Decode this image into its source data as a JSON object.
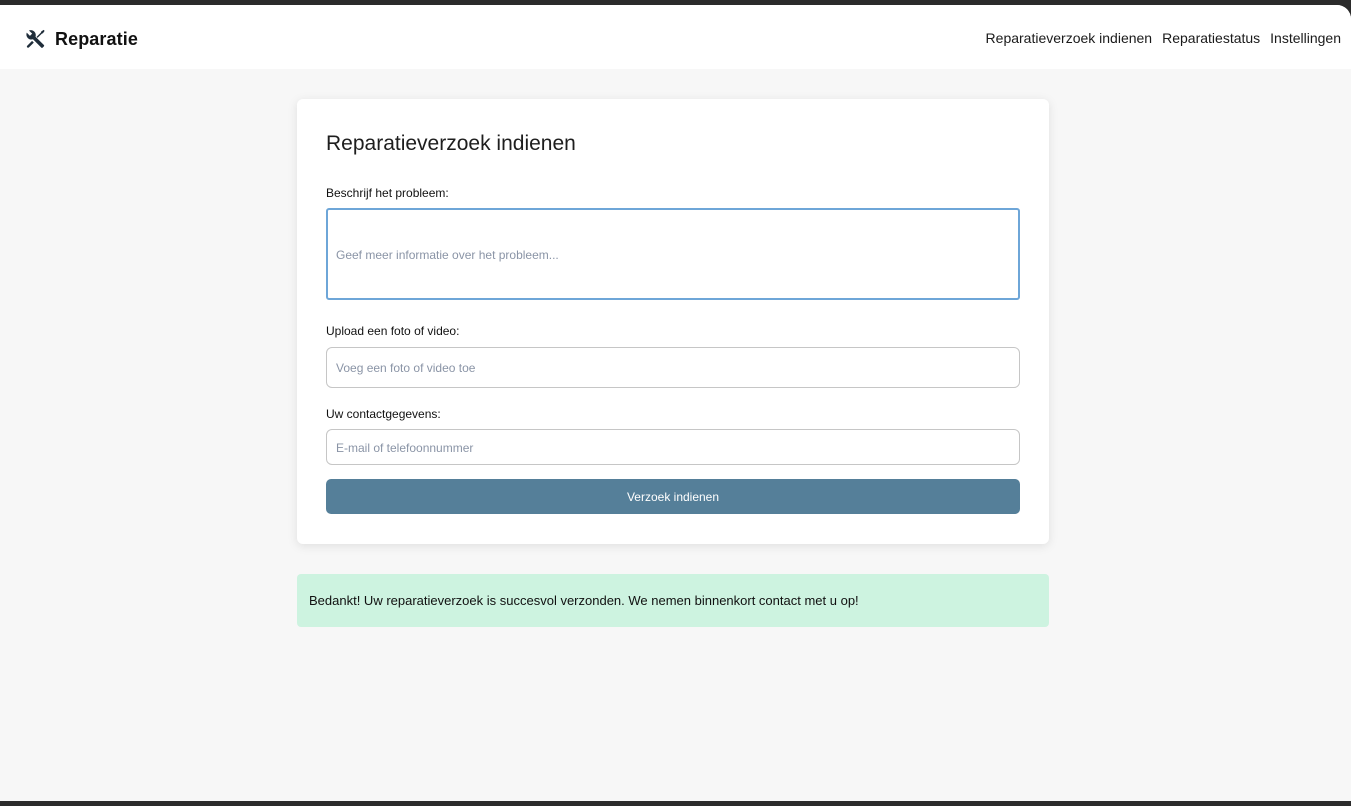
{
  "brand": {
    "name": "Reparatie",
    "icon": "tools-icon"
  },
  "nav": {
    "items": [
      "Reparatieverzoek indienen",
      "Reparatiestatus",
      "Instellingen"
    ]
  },
  "form": {
    "title": "Reparatieverzoek indienen",
    "description": {
      "label": "Beschrijf het probleem:",
      "placeholder": "Geef meer informatie over het probleem..."
    },
    "upload": {
      "label": "Upload een foto of video:",
      "placeholder": "Voeg een foto of video toe"
    },
    "contact": {
      "label": "Uw contactgegevens:",
      "placeholder": "E-mail of telefoonnummer"
    },
    "submit_label": "Verzoek indienen"
  },
  "success_message": "Bedankt! Uw reparatieverzoek is succesvol verzonden. We nemen binnenkort contact met u op!",
  "colors": {
    "button": "#557f99",
    "success_bg": "#cdf3e0",
    "focus_border": "#6ea6d8",
    "background": "#f7f7f7"
  }
}
